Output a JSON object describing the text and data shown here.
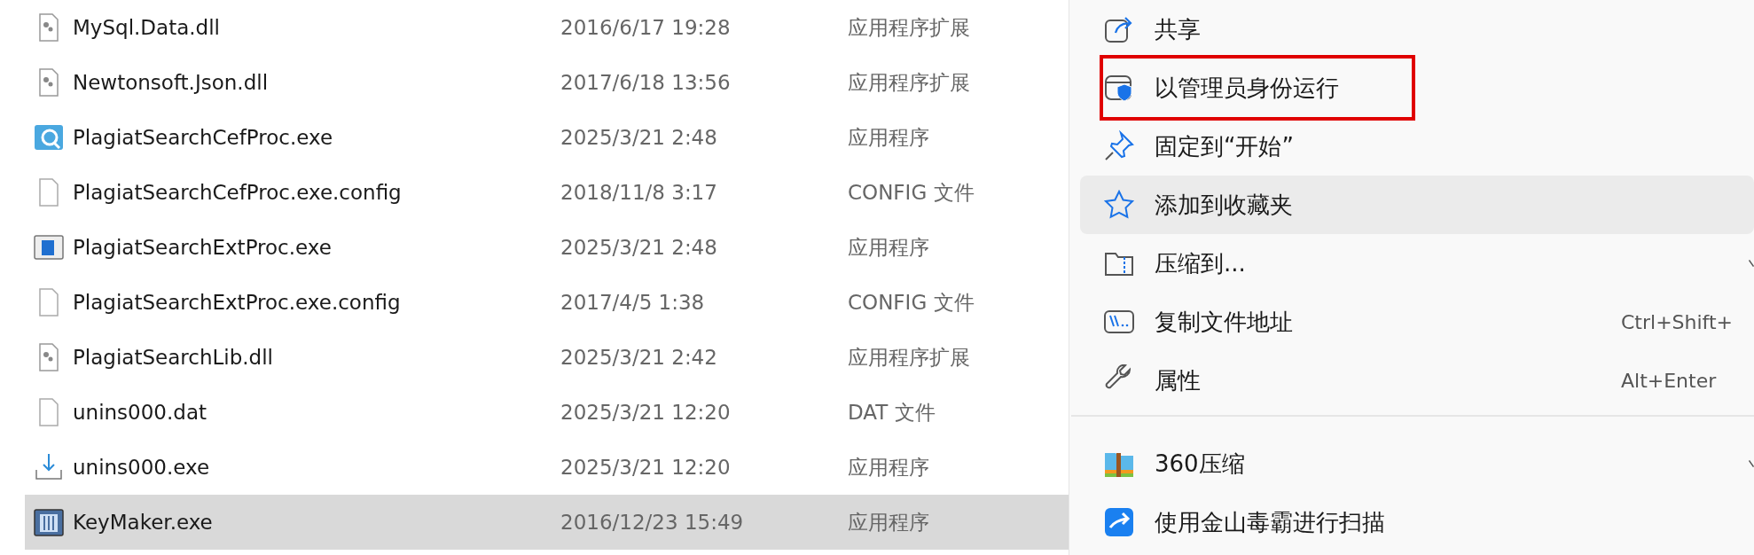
{
  "files": [
    {
      "name": "MySql.Data.dll",
      "date": "2016/6/17 19:28",
      "type": "应用程序扩展",
      "kind": "dll",
      "selected": false
    },
    {
      "name": "Newtonsoft.Json.dll",
      "date": "2017/6/18 13:56",
      "type": "应用程序扩展",
      "kind": "dll",
      "selected": false
    },
    {
      "name": "PlagiatSearchCefProc.exe",
      "date": "2025/3/21 2:48",
      "type": "应用程序",
      "kind": "search-app",
      "selected": false
    },
    {
      "name": "PlagiatSearchCefProc.exe.config",
      "date": "2018/11/8 3:17",
      "type": "CONFIG 文件",
      "kind": "blank",
      "selected": false
    },
    {
      "name": "PlagiatSearchExtProc.exe",
      "date": "2025/3/21 2:48",
      "type": "应用程序",
      "kind": "window-app",
      "selected": false
    },
    {
      "name": "PlagiatSearchExtProc.exe.config",
      "date": "2017/4/5 1:38",
      "type": "CONFIG 文件",
      "kind": "blank",
      "selected": false
    },
    {
      "name": "PlagiatSearchLib.dll",
      "date": "2025/3/21 2:42",
      "type": "应用程序扩展",
      "kind": "dll",
      "selected": false
    },
    {
      "name": "unins000.dat",
      "date": "2025/3/21 12:20",
      "type": "DAT 文件",
      "kind": "blank",
      "selected": false
    },
    {
      "name": "unins000.exe",
      "date": "2025/3/21 12:20",
      "type": "应用程序",
      "kind": "installer",
      "selected": false
    },
    {
      "name": "KeyMaker.exe",
      "date": "2016/12/23 15:49",
      "type": "应用程序",
      "kind": "bars-app",
      "selected": true
    }
  ],
  "context_menu": {
    "items": [
      {
        "kind": "share",
        "label": "共享",
        "hovered": false,
        "annotated": false,
        "submenu": false
      },
      {
        "kind": "shield",
        "label": "以管理员身份运行",
        "hovered": false,
        "annotated": true,
        "submenu": false
      },
      {
        "kind": "pin",
        "label": "固定到“开始”",
        "hovered": false,
        "annotated": false,
        "submenu": false
      },
      {
        "kind": "star",
        "label": "添加到收藏夹",
        "hovered": true,
        "annotated": false,
        "submenu": false
      },
      {
        "kind": "zip-folder",
        "label": "压缩到...",
        "hovered": false,
        "annotated": false,
        "submenu": true
      },
      {
        "kind": "path",
        "label": "复制文件地址",
        "shortcut": "Ctrl+Shift+",
        "hovered": false,
        "annotated": false,
        "submenu": false
      },
      {
        "kind": "wrench",
        "label": "属性",
        "shortcut": "Alt+Enter",
        "hovered": false,
        "annotated": false,
        "submenu": false
      },
      {
        "kind": "separator"
      },
      {
        "kind": "archive",
        "label": "360压缩",
        "hovered": false,
        "annotated": false,
        "submenu": true
      },
      {
        "kind": "scan",
        "label": "使用金山毒霸进行扫描",
        "hovered": false,
        "annotated": false,
        "submenu": false
      }
    ]
  }
}
